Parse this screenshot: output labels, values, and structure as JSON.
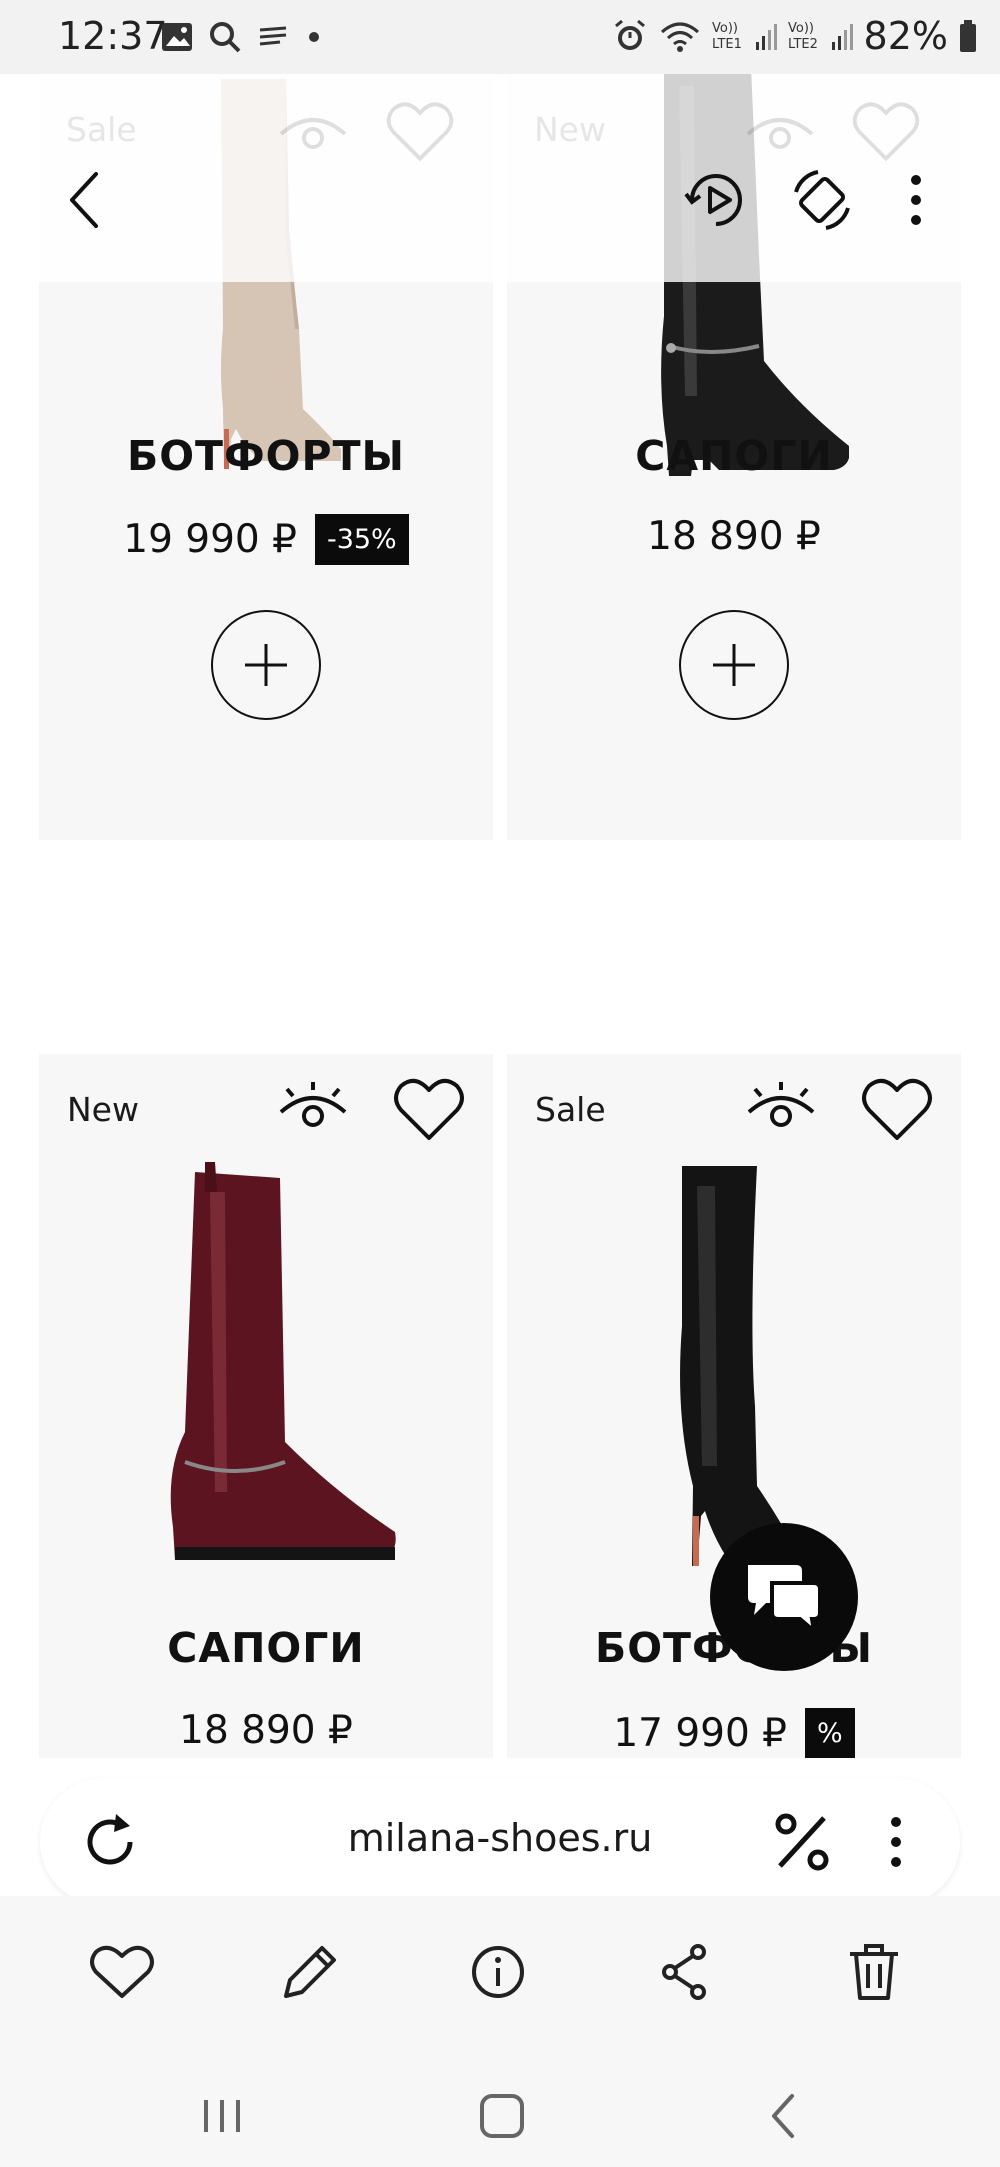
{
  "status_bar": {
    "time": "12:37",
    "battery": "82%",
    "sim1": "Vo)) LTE1",
    "sim2": "Vo)) LTE2"
  },
  "top_overlay": {
    "ghost_left_tag": "Sale",
    "ghost_right_tag": "New"
  },
  "products": [
    {
      "tag": "",
      "title": "БОТФОРТЫ",
      "price": "19 990 ₽",
      "discount": "-35%",
      "image_desc": "beige-stiletto-boot-image"
    },
    {
      "tag": "",
      "title": "САПОГИ",
      "price": "18 890 ₽",
      "discount": "",
      "image_desc": "black-patent-boot-image"
    },
    {
      "tag": "New",
      "title": "САПОГИ",
      "price": "18 890 ₽",
      "discount": "",
      "image_desc": "burgundy-patent-boot-image"
    },
    {
      "tag": "Sale",
      "title": "БОТФОРТЫ",
      "price": "17 990 ₽",
      "discount": "%",
      "image_desc": "black-stiletto-boot-image"
    }
  ],
  "url_bar": {
    "url": "milana-shoes.ru"
  },
  "colors": {
    "card_bg": "#f7f7f7",
    "badge_bg": "#0b0b0b",
    "chat_fab": "#0a0a0a",
    "beige_boot": "#d6c4b5",
    "burgundy_boot": "#5c1520"
  }
}
